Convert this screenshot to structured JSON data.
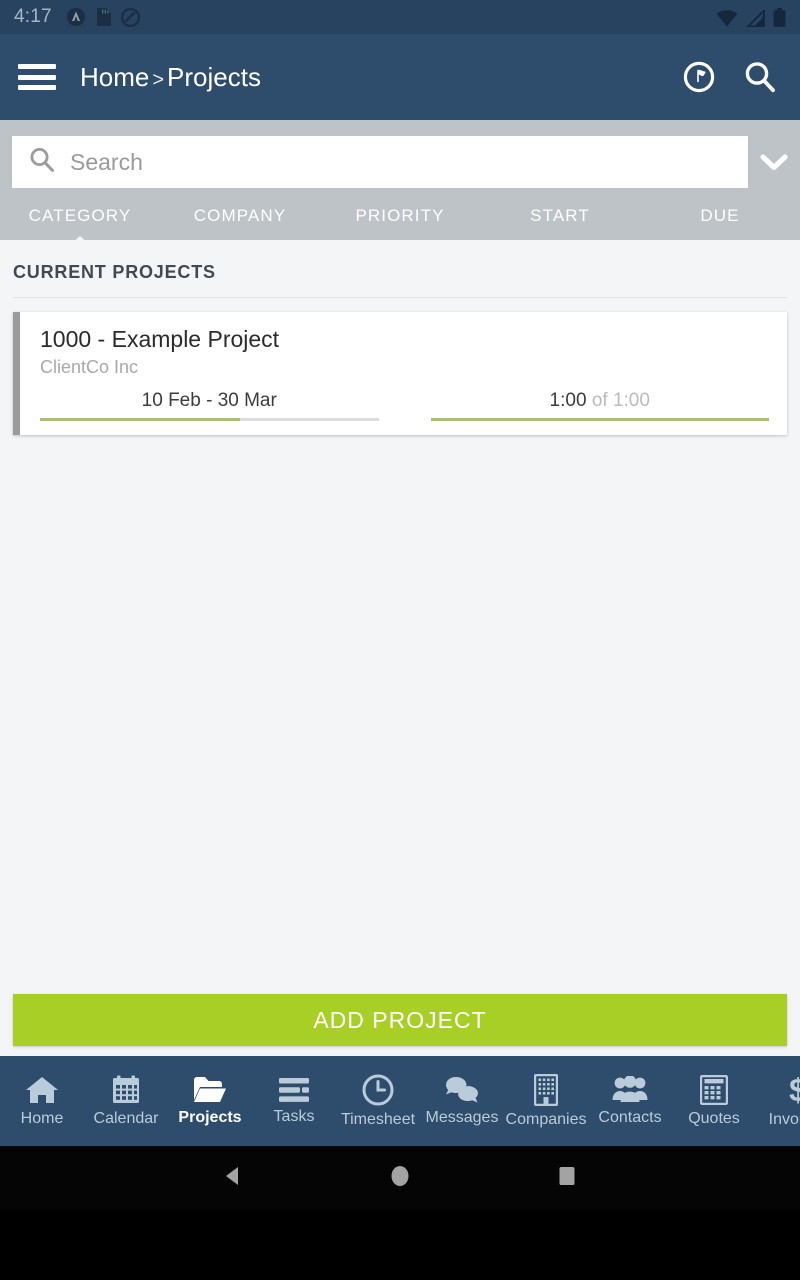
{
  "statusbar": {
    "time": "4:17",
    "left_icons": [
      "app-badge-icon",
      "sd-card-icon",
      "do-not-disturb-icon"
    ],
    "right_icons": [
      "wifi-icon",
      "cell-signal-icon",
      "battery-icon"
    ]
  },
  "header": {
    "menu_icon": "hamburger-menu-icon",
    "breadcrumb_root": "Home",
    "breadcrumb_separator": ">",
    "breadcrumb_current": "Projects",
    "actions": [
      "timer-icon",
      "search-icon"
    ]
  },
  "search": {
    "placeholder": "Search",
    "value": "",
    "icon": "search-icon",
    "expand_icon": "chevron-down-icon"
  },
  "tabs": [
    {
      "label": "CATEGORY",
      "active": true
    },
    {
      "label": "COMPANY",
      "active": false
    },
    {
      "label": "PRIORITY",
      "active": false
    },
    {
      "label": "START",
      "active": false
    },
    {
      "label": "DUE",
      "active": false
    }
  ],
  "main": {
    "section_title": "CURRENT PROJECTS",
    "projects": [
      {
        "title": "1000 - Example Project",
        "company": "ClientCo Inc",
        "date_range": "10 Feb - 30 Mar",
        "date_progress_pct": 59,
        "time_logged": "1:00",
        "time_of": "of",
        "time_total": "1:00",
        "time_progress_pct": 100
      }
    ]
  },
  "add_button": {
    "label": "ADD PROJECT"
  },
  "bottomnav": {
    "items": [
      {
        "label": "Home",
        "icon": "home-icon",
        "active": false
      },
      {
        "label": "Calendar",
        "icon": "calendar-icon",
        "active": false
      },
      {
        "label": "Projects",
        "icon": "folder-icon",
        "active": true
      },
      {
        "label": "Tasks",
        "icon": "list-icon",
        "active": false
      },
      {
        "label": "Timesheet",
        "icon": "clock-icon",
        "active": false
      },
      {
        "label": "Messages",
        "icon": "chat-bubbles-icon",
        "active": false
      },
      {
        "label": "Companies",
        "icon": "building-icon",
        "active": false
      },
      {
        "label": "Contacts",
        "icon": "people-icon",
        "active": false
      },
      {
        "label": "Quotes",
        "icon": "calculator-icon",
        "active": false
      },
      {
        "label": "Invoices",
        "icon": "dollar-icon",
        "active": false
      }
    ]
  },
  "sysnav": {
    "back": "back-triangle-icon",
    "home": "home-circle-icon",
    "recents": "recents-square-icon"
  },
  "colors": {
    "header_blue": "#2E4C6B",
    "status_blue": "#27435F",
    "filter_gray": "#BEC3C7",
    "content_bg": "#F4F5F7",
    "accent_green": "#A8CF26",
    "progress_green": "#A9BE76"
  }
}
